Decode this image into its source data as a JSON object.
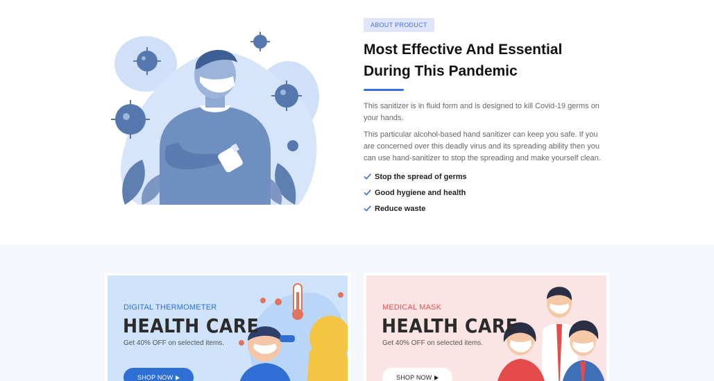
{
  "about": {
    "badge": "ABOUT PRODUCT",
    "title_line1": "Most Effective And Essential",
    "title_line2": "During This Pandemic",
    "paragraph1": "This sanitizer is in fluid form and is designed to kill Covid-19 germs on your hands.",
    "paragraph2": "This particular alcohol-based hand sanitizer can keep you safe. If you are concerned over this deadly virus and its spreading ability then you can use hand-sanitizer to stop the spreading and make yourself clean.",
    "features": [
      "Stop the spread of germs",
      "Good hygiene and health",
      "Reduce waste"
    ],
    "accent_color": "#3b6fe0",
    "check_icon": "check-icon"
  },
  "promos": [
    {
      "subtitle": "DIGITAL THERMOMETER",
      "title": "HEALTH CARE",
      "description": "Get 40% OFF on selected items.",
      "button_label": "SHOP NOW",
      "button_icon": "caret-right-icon",
      "background": "#cfe3fb"
    },
    {
      "subtitle": "MEDICAL MASK",
      "title": "HEALTH CARE",
      "description": "Get 40% OFF on selected items.",
      "button_label": "SHOP NOW",
      "button_icon": "caret-right-icon",
      "background": "#fbe4e4"
    }
  ]
}
